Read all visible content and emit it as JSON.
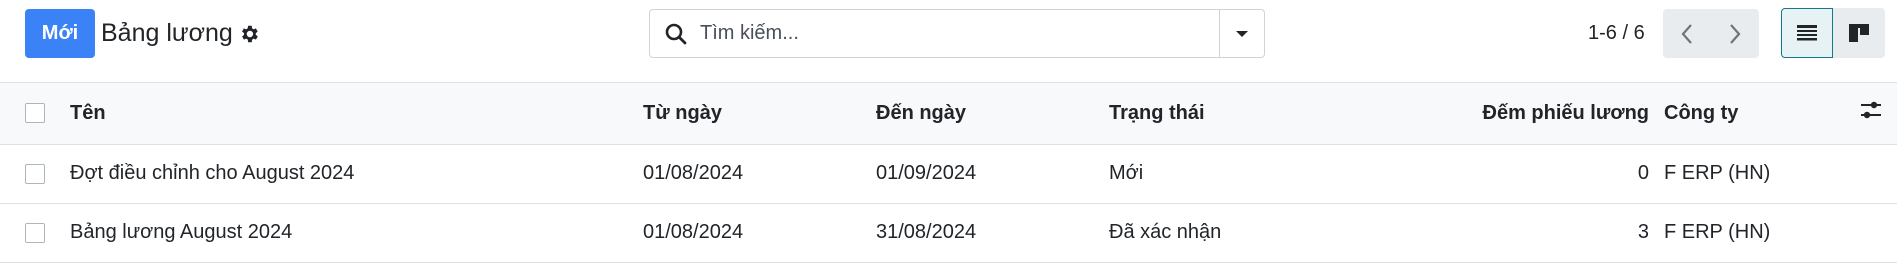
{
  "control_panel": {
    "new_button_label": "Mới",
    "title": "Bảng lương",
    "search_placeholder": "Tìm kiếm...",
    "pager_value": "1-6 / 6",
    "icons": {
      "settings": "gear-icon",
      "search": "search-icon",
      "search_toggle": "caret-down-icon",
      "prev": "chevron-left-icon",
      "next": "chevron-right-icon",
      "list_view": "list-view-icon",
      "kanban_view": "kanban-view-icon"
    },
    "accent_color": "#3b82f6"
  },
  "table": {
    "columns": [
      "Tên",
      "Từ ngày",
      "Đến ngày",
      "Trạng thái",
      "Đếm phiếu lương",
      "Công ty"
    ],
    "rows": [
      {
        "name": "Đợt điều chỉnh cho August 2024",
        "date_from": "01/08/2024",
        "date_to": "01/09/2024",
        "state": "Mới",
        "payslip_count": "0",
        "company": "F ERP (HN)"
      },
      {
        "name": "Bảng lương August 2024",
        "date_from": "01/08/2024",
        "date_to": "31/08/2024",
        "state": "Đã xác nhận",
        "payslip_count": "3",
        "company": "F ERP (HN)"
      }
    ],
    "optional_columns_icon": "sliders-icon"
  }
}
